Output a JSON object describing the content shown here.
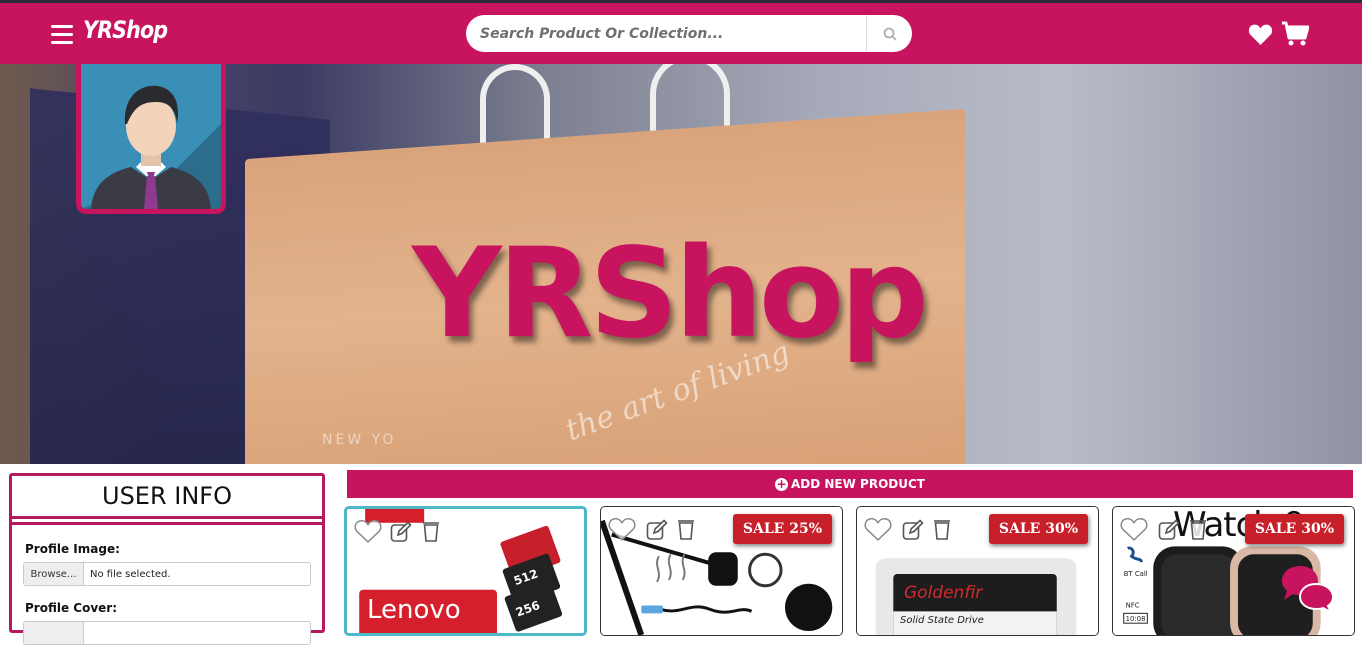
{
  "navbar": {
    "brand": "YRShop",
    "search_placeholder": "Search Product Or Collection...",
    "bg_color": "#c8135f"
  },
  "hero": {
    "title": "YRShop",
    "bag_text": "the art of living",
    "bag_text2": "NEW YO"
  },
  "user_info": {
    "title": "USER INFO",
    "profile_image_label": "Profile Image:",
    "profile_cover_label": "Profile Cover:",
    "browse_label": "Browse...",
    "no_file_text": "No file selected."
  },
  "products": {
    "add_label": "ADD NEW PRODUCT",
    "items": [
      {
        "brand": "Lenovo",
        "sale": ""
      },
      {
        "brand": "",
        "sale": "SALE 25%"
      },
      {
        "brand": "Goldenfir",
        "subtitle": "Solid State Drive",
        "sale": "SALE 30%"
      },
      {
        "brand": "Watch 9",
        "sale": "SALE 30%"
      }
    ]
  },
  "colors": {
    "brand": "#c8135f",
    "sale": "#c8202a",
    "selected_border": "#4fb8c8"
  }
}
